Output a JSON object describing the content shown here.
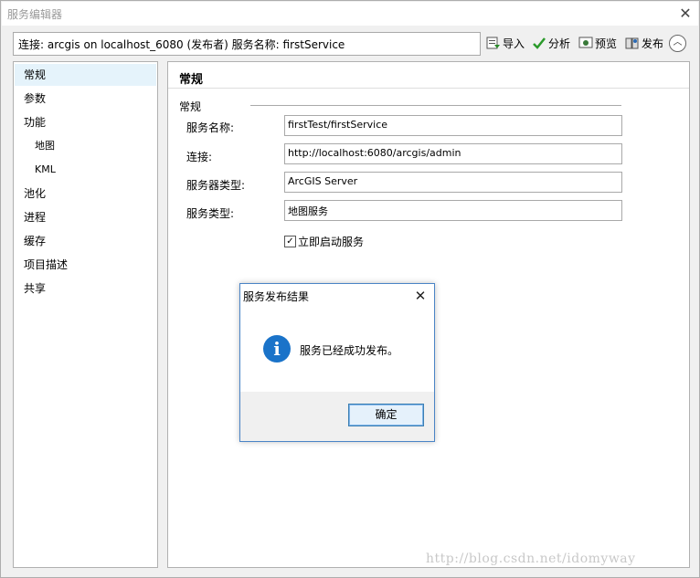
{
  "window": {
    "title": "服务编辑器"
  },
  "connection": {
    "text": "连接: arcgis on localhost_6080 (发布者)    服务名称: firstService"
  },
  "toolbar": {
    "import_label": "导入",
    "analyze_label": "分析",
    "preview_label": "预览",
    "publish_label": "发布"
  },
  "sidebar": {
    "items": [
      {
        "label": "常规",
        "selected": true
      },
      {
        "label": "参数"
      },
      {
        "label": "功能"
      },
      {
        "label": "地图",
        "sub": true
      },
      {
        "label": "KML",
        "sub": true
      },
      {
        "label": "池化"
      },
      {
        "label": "进程"
      },
      {
        "label": "缓存"
      },
      {
        "label": "项目描述"
      },
      {
        "label": "共享"
      }
    ]
  },
  "main": {
    "title": "常规",
    "section": "常规",
    "fields": [
      {
        "label": "服务名称:",
        "value": "firstTest/firstService"
      },
      {
        "label": "连接:",
        "value": "http://localhost:6080/arcgis/admin"
      },
      {
        "label": "服务器类型:",
        "value": "ArcGIS Server"
      },
      {
        "label": "服务类型:",
        "value": "地图服务"
      }
    ],
    "autostart": {
      "label": "立即启动服务",
      "checked": true
    }
  },
  "dialog": {
    "title": "服务发布结果",
    "message": "服务已经成功发布。",
    "ok_label": "确定"
  },
  "watermark": "http://blog.csdn.net/idomyway"
}
